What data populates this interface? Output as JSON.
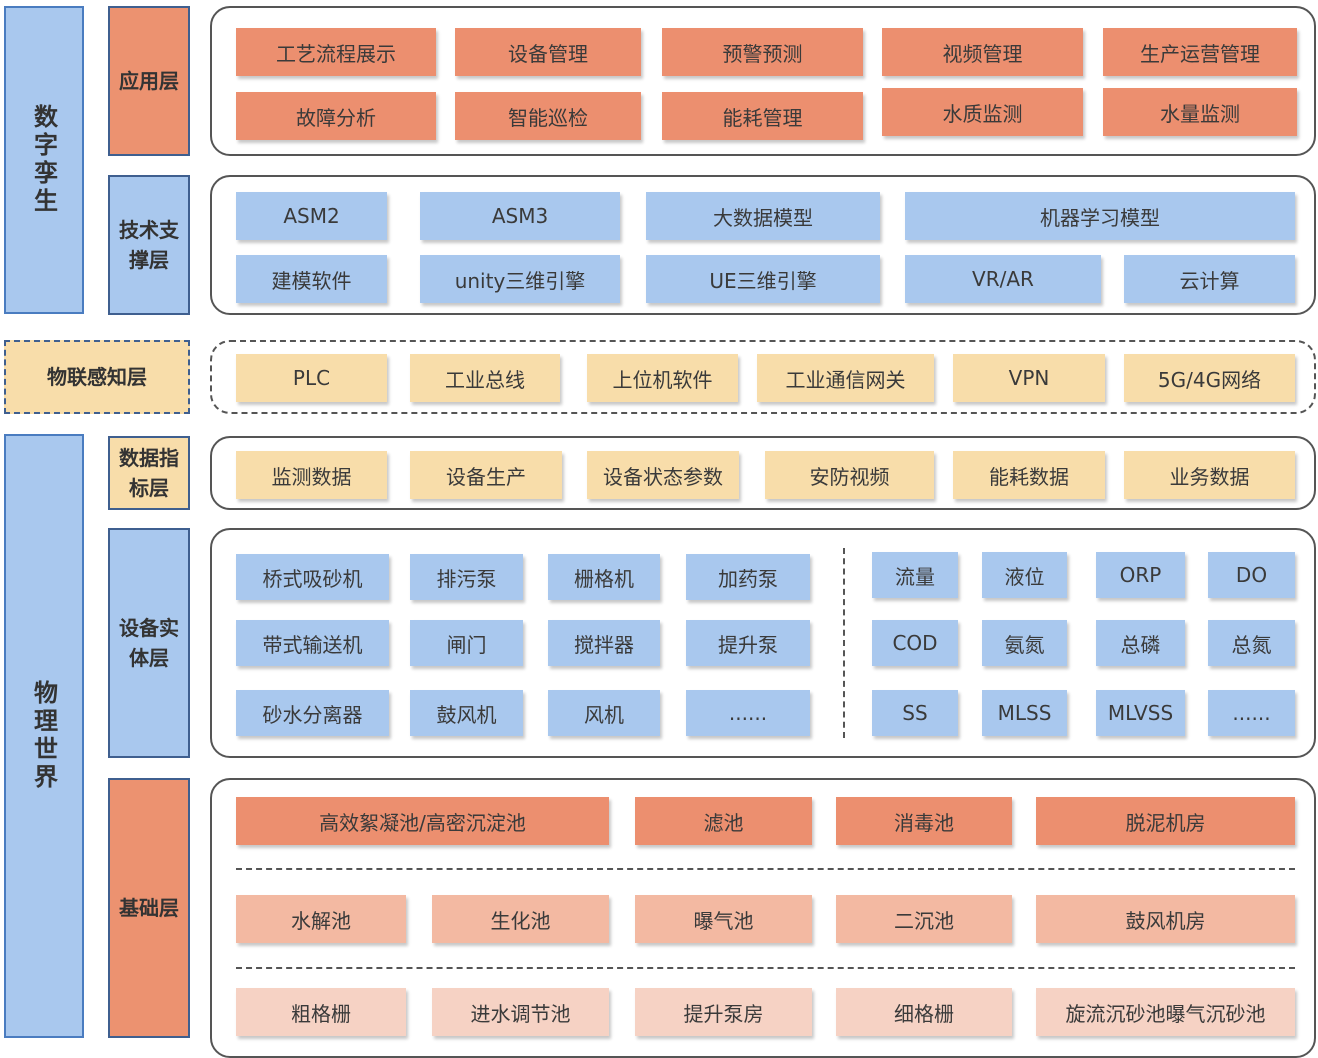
{
  "left_labels": {
    "digital_twin": "数字孪生",
    "physical_world": "物理世界"
  },
  "layers": {
    "application": {
      "label": "应用层",
      "items": [
        "工艺流程展示",
        "设备管理",
        "预警预测",
        "视频管理",
        "生产运营管理",
        "故障分析",
        "智能巡检",
        "能耗管理",
        "水质监测",
        "水量监测"
      ]
    },
    "tech_support": {
      "label": "技术支撑层",
      "items": [
        "ASM2",
        "ASM3",
        "大数据模型",
        "机器学习模型",
        "建模软件",
        "unity三维引擎",
        "UE三维引擎",
        "VR/AR",
        "云计算"
      ]
    },
    "iot": {
      "label": "物联感知层",
      "items": [
        "PLC",
        "工业总线",
        "上位机软件",
        "工业通信网关",
        "VPN",
        "5G/4G网络"
      ]
    },
    "data_index": {
      "label": "数据指标层",
      "items": [
        "监测数据",
        "设备生产",
        "设备状态参数",
        "安防视频",
        "能耗数据",
        "业务数据"
      ]
    },
    "equipment": {
      "label": "设备实体层",
      "devices": [
        "桥式吸砂机",
        "排污泵",
        "栅格机",
        "加药泵",
        "带式输送机",
        "闸门",
        "搅拌器",
        "提升泵",
        "砂水分离器",
        "鼓风机",
        "风机",
        "......"
      ],
      "sensors": [
        "流量",
        "液位",
        "ORP",
        "DO",
        "COD",
        "氨氮",
        "总磷",
        "总氮",
        "SS",
        "MLSS",
        "MLVSS",
        "......"
      ]
    },
    "foundation": {
      "label": "基础层",
      "row1": [
        "高效絮凝池/高密沉淀池",
        "滤池",
        "消毒池",
        "脱泥机房"
      ],
      "row2": [
        "水解池",
        "生化池",
        "曝气池",
        "二沉池",
        "鼓风机房"
      ],
      "row3": [
        "粗格栅",
        "进水调节池",
        "提升泵房",
        "细格栅",
        "旋流沉砂池曝气沉砂池"
      ]
    }
  },
  "colors": {
    "orange": "#ec8f6f",
    "light_orange": "#f3b9a2",
    "pale_orange": "#f6d2c4",
    "blue": "#a9c8ee",
    "yellow": "#f8ddaa"
  }
}
